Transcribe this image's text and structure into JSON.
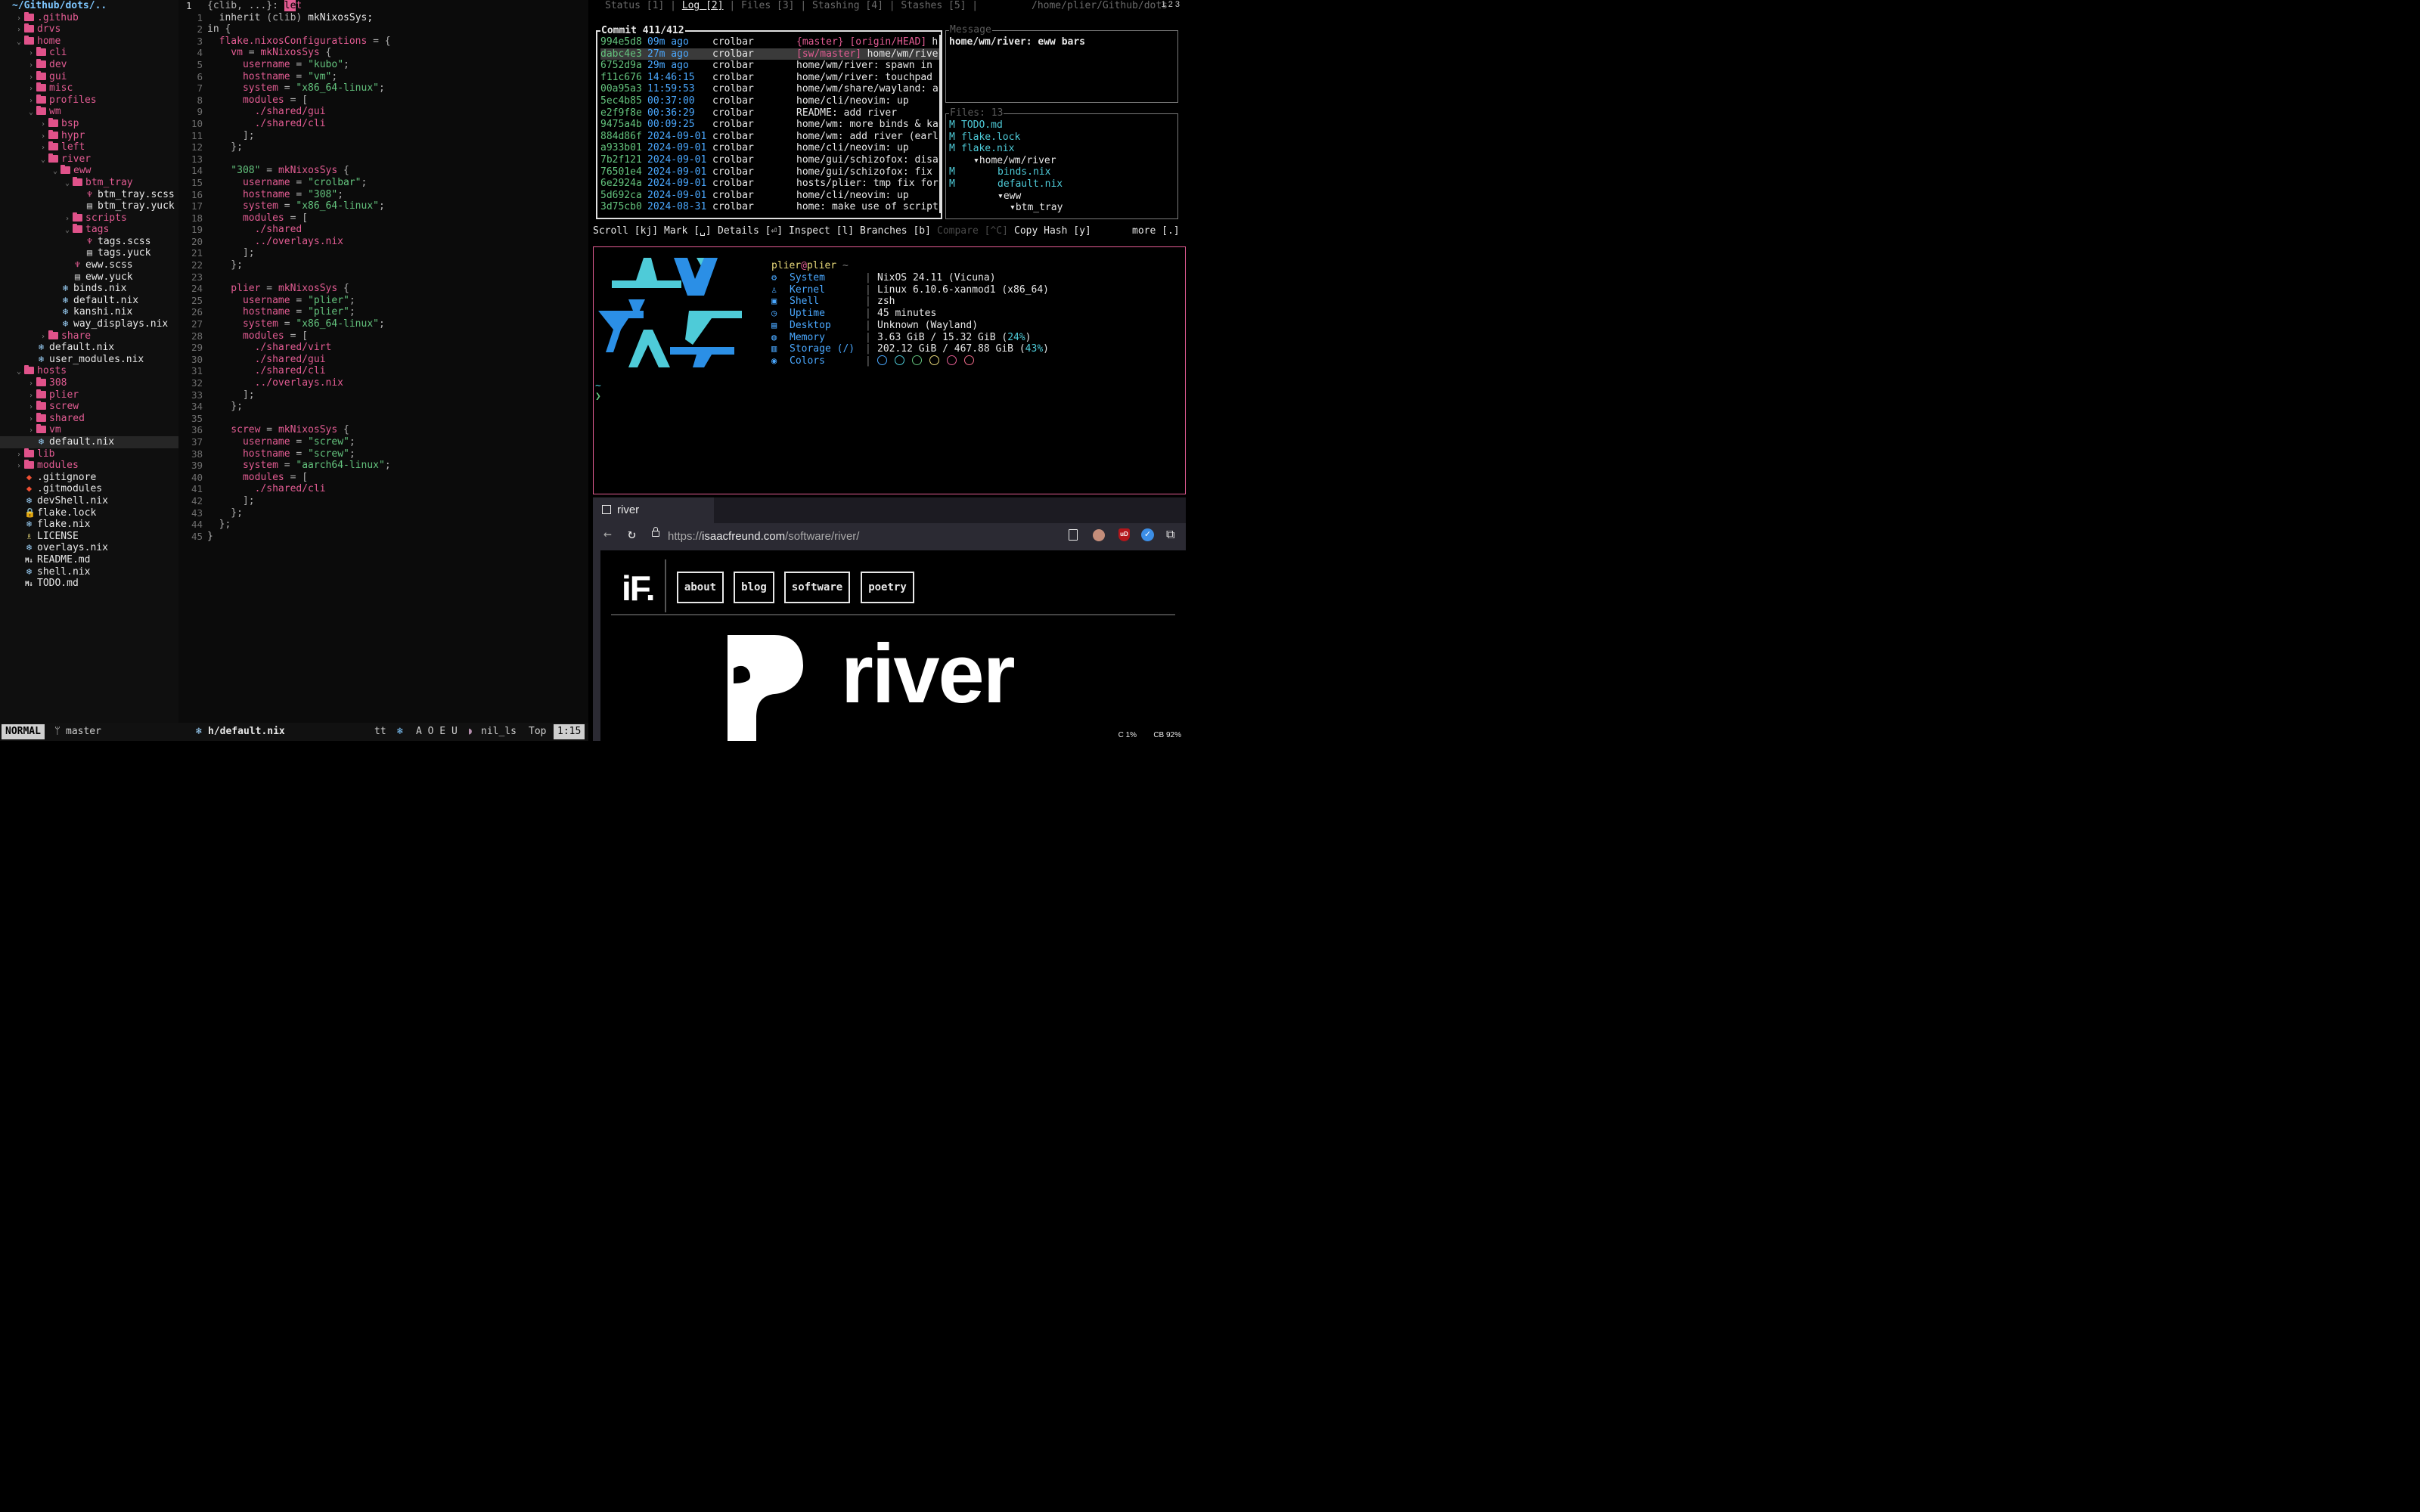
{
  "nvim": {
    "root": "~/Github/dots/..",
    "tree": [
      {
        "indent": 1,
        "chev": "›",
        "type": "dir",
        "name": ".github"
      },
      {
        "indent": 1,
        "chev": "›",
        "type": "dir",
        "name": "drvs"
      },
      {
        "indent": 1,
        "chev": "⌄",
        "type": "dir",
        "name": "home"
      },
      {
        "indent": 2,
        "chev": "›",
        "type": "dir",
        "name": "cli"
      },
      {
        "indent": 2,
        "chev": "›",
        "type": "dir",
        "name": "dev"
      },
      {
        "indent": 2,
        "chev": "›",
        "type": "dir",
        "name": "gui"
      },
      {
        "indent": 2,
        "chev": "›",
        "type": "dir",
        "name": "misc"
      },
      {
        "indent": 2,
        "chev": "›",
        "type": "dir",
        "name": "profiles"
      },
      {
        "indent": 2,
        "chev": "⌄",
        "type": "dir",
        "name": "wm"
      },
      {
        "indent": 3,
        "chev": "›",
        "type": "dir",
        "name": "bsp"
      },
      {
        "indent": 3,
        "chev": "›",
        "type": "dir",
        "name": "hypr"
      },
      {
        "indent": 3,
        "chev": "›",
        "type": "dir",
        "name": "left"
      },
      {
        "indent": 3,
        "chev": "⌄",
        "type": "dir",
        "name": "river"
      },
      {
        "indent": 4,
        "chev": "⌄",
        "type": "dir",
        "name": "eww"
      },
      {
        "indent": 5,
        "chev": "⌄",
        "type": "dir",
        "name": "btm_tray"
      },
      {
        "indent": 6,
        "chev": "",
        "type": "scss",
        "name": "btm_tray.scss"
      },
      {
        "indent": 6,
        "chev": "",
        "type": "yuck",
        "name": "btm_tray.yuck"
      },
      {
        "indent": 5,
        "chev": "›",
        "type": "dir",
        "name": "scripts"
      },
      {
        "indent": 5,
        "chev": "⌄",
        "type": "dir",
        "name": "tags"
      },
      {
        "indent": 6,
        "chev": "",
        "type": "scss",
        "name": "tags.scss"
      },
      {
        "indent": 6,
        "chev": "",
        "type": "yuck",
        "name": "tags.yuck"
      },
      {
        "indent": 5,
        "chev": "",
        "type": "scss",
        "name": "eww.scss"
      },
      {
        "indent": 5,
        "chev": "",
        "type": "yuck",
        "name": "eww.yuck"
      },
      {
        "indent": 4,
        "chev": "",
        "type": "nix",
        "name": "binds.nix"
      },
      {
        "indent": 4,
        "chev": "",
        "type": "nix",
        "name": "default.nix"
      },
      {
        "indent": 4,
        "chev": "",
        "type": "nix",
        "name": "kanshi.nix"
      },
      {
        "indent": 4,
        "chev": "",
        "type": "nix",
        "name": "way_displays.nix"
      },
      {
        "indent": 3,
        "chev": "›",
        "type": "dir",
        "name": "share"
      },
      {
        "indent": 2,
        "chev": "",
        "type": "nix",
        "name": "default.nix"
      },
      {
        "indent": 2,
        "chev": "",
        "type": "nix",
        "name": "user_modules.nix"
      },
      {
        "indent": 1,
        "chev": "⌄",
        "type": "dir",
        "name": "hosts"
      },
      {
        "indent": 2,
        "chev": "›",
        "type": "dir",
        "name": "308"
      },
      {
        "indent": 2,
        "chev": "›",
        "type": "dir",
        "name": "plier"
      },
      {
        "indent": 2,
        "chev": "›",
        "type": "dir",
        "name": "screw"
      },
      {
        "indent": 2,
        "chev": "›",
        "type": "dir",
        "name": "shared"
      },
      {
        "indent": 2,
        "chev": "›",
        "type": "dir",
        "name": "vm"
      },
      {
        "indent": 2,
        "chev": "",
        "type": "nix",
        "name": "default.nix",
        "selected": true
      },
      {
        "indent": 1,
        "chev": "›",
        "type": "dir",
        "name": "lib"
      },
      {
        "indent": 1,
        "chev": "›",
        "type": "dir",
        "name": "modules"
      },
      {
        "indent": 1,
        "chev": "",
        "type": "git",
        "name": ".gitignore"
      },
      {
        "indent": 1,
        "chev": "",
        "type": "git",
        "name": ".gitmodules"
      },
      {
        "indent": 1,
        "chev": "",
        "type": "nix",
        "name": "devShell.nix"
      },
      {
        "indent": 1,
        "chev": "",
        "type": "lock",
        "name": "flake.lock"
      },
      {
        "indent": 1,
        "chev": "",
        "type": "nix",
        "name": "flake.nix"
      },
      {
        "indent": 1,
        "chev": "",
        "type": "license",
        "name": "LICENSE"
      },
      {
        "indent": 1,
        "chev": "",
        "type": "nix",
        "name": "overlays.nix"
      },
      {
        "indent": 1,
        "chev": "",
        "type": "md",
        "name": "README.md"
      },
      {
        "indent": 1,
        "chev": "",
        "type": "nix",
        "name": "shell.nix"
      },
      {
        "indent": 1,
        "chev": "",
        "type": "md",
        "name": "TODO.md"
      }
    ],
    "line_numbers": [
      "1",
      "1",
      "2",
      "3",
      "4",
      "5",
      "6",
      "7",
      "8",
      "9",
      "10",
      "11",
      "12",
      "13",
      "14",
      "15",
      "16",
      "17",
      "18",
      "19",
      "20",
      "21",
      "22",
      "23",
      "24",
      "25",
      "26",
      "27",
      "28",
      "29",
      "30",
      "31",
      "32",
      "33",
      "34",
      "35",
      "36",
      "37",
      "38",
      "39",
      "40",
      "41",
      "42",
      "43",
      "44",
      "45"
    ],
    "code": [
      [
        [
          "p",
          "{clib, ...}: "
        ],
        [
          "cursor",
          "le"
        ],
        [
          "a",
          "t"
        ]
      ],
      [
        [
          "k",
          "  inherit "
        ],
        [
          "p",
          "(clib) "
        ],
        [
          "fn",
          "mkNixosSys;"
        ]
      ],
      [
        [
          "k",
          "in "
        ],
        [
          "p",
          "{"
        ]
      ],
      [
        [
          "a",
          "  flake.nixosConfigurations "
        ],
        [
          "p",
          "= {"
        ]
      ],
      [
        [
          "a",
          "    vm "
        ],
        [
          "p",
          "= "
        ],
        [
          "a",
          "mkNixosSys "
        ],
        [
          "p",
          "{"
        ]
      ],
      [
        [
          "a",
          "      username "
        ],
        [
          "p",
          "= "
        ],
        [
          "s",
          "\"kubo\""
        ],
        [
          "p",
          ";"
        ]
      ],
      [
        [
          "a",
          "      hostname "
        ],
        [
          "p",
          "= "
        ],
        [
          "s",
          "\"vm\""
        ],
        [
          "p",
          ";"
        ]
      ],
      [
        [
          "a",
          "      system "
        ],
        [
          "p",
          "= "
        ],
        [
          "s",
          "\"x86_64-linux\""
        ],
        [
          "p",
          ";"
        ]
      ],
      [
        [
          "a",
          "      modules "
        ],
        [
          "p",
          "= ["
        ]
      ],
      [
        [
          "path",
          "        ./shared/gui"
        ]
      ],
      [
        [
          "path",
          "        ./shared/cli"
        ]
      ],
      [
        [
          "p",
          "      ];"
        ]
      ],
      [
        [
          "p",
          "    };"
        ]
      ],
      [
        [
          "p",
          ""
        ]
      ],
      [
        [
          "s",
          "    \"308\" "
        ],
        [
          "p",
          "= "
        ],
        [
          "a",
          "mkNixosSys "
        ],
        [
          "p",
          "{"
        ]
      ],
      [
        [
          "a",
          "      username "
        ],
        [
          "p",
          "= "
        ],
        [
          "s",
          "\"crolbar\""
        ],
        [
          "p",
          ";"
        ]
      ],
      [
        [
          "a",
          "      hostname "
        ],
        [
          "p",
          "= "
        ],
        [
          "s",
          "\"308\""
        ],
        [
          "p",
          ";"
        ]
      ],
      [
        [
          "a",
          "      system "
        ],
        [
          "p",
          "= "
        ],
        [
          "s",
          "\"x86_64-linux\""
        ],
        [
          "p",
          ";"
        ]
      ],
      [
        [
          "a",
          "      modules "
        ],
        [
          "p",
          "= ["
        ]
      ],
      [
        [
          "path",
          "        ./shared"
        ]
      ],
      [
        [
          "path",
          "        ../overlays.nix"
        ]
      ],
      [
        [
          "p",
          "      ];"
        ]
      ],
      [
        [
          "p",
          "    };"
        ]
      ],
      [
        [
          "p",
          ""
        ]
      ],
      [
        [
          "a",
          "    plier "
        ],
        [
          "p",
          "= "
        ],
        [
          "a",
          "mkNixosSys "
        ],
        [
          "p",
          "{"
        ]
      ],
      [
        [
          "a",
          "      username "
        ],
        [
          "p",
          "= "
        ],
        [
          "s",
          "\"plier\""
        ],
        [
          "p",
          ";"
        ]
      ],
      [
        [
          "a",
          "      hostname "
        ],
        [
          "p",
          "= "
        ],
        [
          "s",
          "\"plier\""
        ],
        [
          "p",
          ";"
        ]
      ],
      [
        [
          "a",
          "      system "
        ],
        [
          "p",
          "= "
        ],
        [
          "s",
          "\"x86_64-linux\""
        ],
        [
          "p",
          ";"
        ]
      ],
      [
        [
          "a",
          "      modules "
        ],
        [
          "p",
          "= ["
        ]
      ],
      [
        [
          "path",
          "        ./shared/virt"
        ]
      ],
      [
        [
          "path",
          "        ./shared/gui"
        ]
      ],
      [
        [
          "path",
          "        ./shared/cli"
        ]
      ],
      [
        [
          "path",
          "        ../overlays.nix"
        ]
      ],
      [
        [
          "p",
          "      ];"
        ]
      ],
      [
        [
          "p",
          "    };"
        ]
      ],
      [
        [
          "p",
          ""
        ]
      ],
      [
        [
          "a",
          "    screw "
        ],
        [
          "p",
          "= "
        ],
        [
          "a",
          "mkNixosSys "
        ],
        [
          "p",
          "{"
        ]
      ],
      [
        [
          "a",
          "      username "
        ],
        [
          "p",
          "= "
        ],
        [
          "s",
          "\"screw\""
        ],
        [
          "p",
          ";"
        ]
      ],
      [
        [
          "a",
          "      hostname "
        ],
        [
          "p",
          "= "
        ],
        [
          "s",
          "\"screw\""
        ],
        [
          "p",
          ";"
        ]
      ],
      [
        [
          "a",
          "      system "
        ],
        [
          "p",
          "= "
        ],
        [
          "s",
          "\"aarch64-linux\""
        ],
        [
          "p",
          ";"
        ]
      ],
      [
        [
          "a",
          "      modules "
        ],
        [
          "p",
          "= ["
        ]
      ],
      [
        [
          "path",
          "        ./shared/cli"
        ]
      ],
      [
        [
          "p",
          "      ];"
        ]
      ],
      [
        [
          "p",
          "    };"
        ]
      ],
      [
        [
          "p",
          "  };"
        ]
      ],
      [
        [
          "p",
          "}"
        ]
      ]
    ],
    "status": {
      "mode": "NORMAL",
      "branch": "master",
      "file": "h/default.nix",
      "ft": "tt",
      "layout": "A O E U",
      "lsp": "nil_ls",
      "scroll": "Top",
      "pos": "1:15"
    }
  },
  "lazygit": {
    "tabs": [
      "Status [1]",
      "Log [2]",
      "Files [3]",
      "Stashing [4]",
      "Stashes [5]"
    ],
    "active_tab": "Log [2]",
    "path": "/home/plier/Github/dots",
    "ws": "1 2 3",
    "commit_title": "Commit 411/412",
    "commits": [
      {
        "hash": "994e5d8",
        "ago": "09m ago",
        "author": "crolbar",
        "tag": "{master} [origin/HEAD]",
        "msg": "h"
      },
      {
        "hash": "dabc4e3",
        "ago": "27m ago",
        "author": "crolbar",
        "tag": "[sw/master]",
        "msg": "home/wm/rive",
        "selected": true
      },
      {
        "hash": "6752d9a",
        "ago": "29m ago",
        "author": "crolbar",
        "tag": "",
        "msg": "home/wm/river: spawn in"
      },
      {
        "hash": "f11c676",
        "ago": "14:46:15",
        "author": "crolbar",
        "tag": "",
        "msg": "home/wm/river: touchpad"
      },
      {
        "hash": "00a95a3",
        "ago": "11:59:53",
        "author": "crolbar",
        "tag": "",
        "msg": "home/wm/share/wayland: a"
      },
      {
        "hash": "5ec4b85",
        "ago": "00:37:00",
        "author": "crolbar",
        "tag": "",
        "msg": "home/cli/neovim: up"
      },
      {
        "hash": "e2f9f8e",
        "ago": "00:36:29",
        "author": "crolbar",
        "tag": "",
        "msg": "README: add river"
      },
      {
        "hash": "9475a4b",
        "ago": "00:09:25",
        "author": "crolbar",
        "tag": "",
        "msg": "home/wm: more binds & ka"
      },
      {
        "hash": "884d86f",
        "ago": "2024-09-01",
        "author": "crolbar",
        "tag": "",
        "msg": "home/wm: add river (earl"
      },
      {
        "hash": "a933b01",
        "ago": "2024-09-01",
        "author": "crolbar",
        "tag": "",
        "msg": "home/cli/neovim: up"
      },
      {
        "hash": "7b2f121",
        "ago": "2024-09-01",
        "author": "crolbar",
        "tag": "",
        "msg": "home/gui/schizofox: disa"
      },
      {
        "hash": "76501e4",
        "ago": "2024-09-01",
        "author": "crolbar",
        "tag": "",
        "msg": "home/gui/schizofox: fix"
      },
      {
        "hash": "6e2924a",
        "ago": "2024-09-01",
        "author": "crolbar",
        "tag": "",
        "msg": "hosts/plier: tmp fix for"
      },
      {
        "hash": "5d692ca",
        "ago": "2024-09-01",
        "author": "crolbar",
        "tag": "",
        "msg": "home/cli/neovim: up"
      },
      {
        "hash": "3d75cb0",
        "ago": "2024-08-31",
        "author": "crolbar",
        "tag": "",
        "msg": "home: make use of script"
      }
    ],
    "message_title": "Message",
    "message": "home/wm/river: eww bars",
    "files_title": "Files: 13",
    "files": [
      {
        "m": "M",
        "indent": 0,
        "name": "TODO.md"
      },
      {
        "m": "M",
        "indent": 0,
        "name": "flake.lock"
      },
      {
        "m": "M",
        "indent": 0,
        "name": "flake.nix"
      },
      {
        "m": "",
        "indent": 1,
        "name": "▾home/wm/river",
        "dir": true
      },
      {
        "m": "M",
        "indent": 3,
        "name": "binds.nix"
      },
      {
        "m": "M",
        "indent": 3,
        "name": "default.nix"
      },
      {
        "m": "",
        "indent": 3,
        "name": "▾eww",
        "dir": true
      },
      {
        "m": "",
        "indent": 4,
        "name": "▾btm_tray",
        "dir": true
      }
    ],
    "keybar": [
      {
        "label": "Scroll [kj]",
        "dim": false
      },
      {
        "label": "Mark [␣]",
        "dim": false
      },
      {
        "label": "Details [⏎]",
        "dim": false
      },
      {
        "label": "Inspect [l]",
        "dim": false
      },
      {
        "label": "Branches [b]",
        "dim": false
      },
      {
        "label": "Compare [^C]",
        "dim": true
      },
      {
        "label": "Copy Hash [y]",
        "dim": false
      },
      {
        "label": "more [.]",
        "dim": false
      }
    ]
  },
  "terminal": {
    "user": "plier",
    "at": "@",
    "host": "plier",
    "tilde": "~",
    "info": [
      {
        "icon": "gear-icon",
        "glyph": "⚙",
        "label": "System",
        "value": "NixOS 24.11 (Vicuna)"
      },
      {
        "icon": "penguin-icon",
        "glyph": "♙",
        "label": "Kernel",
        "value": "Linux 6.10.6-xanmod1 (x86_64)"
      },
      {
        "icon": "shell-icon",
        "glyph": "▣",
        "label": "Shell",
        "value": "zsh"
      },
      {
        "icon": "clock-icon",
        "glyph": "◷",
        "label": "Uptime",
        "value": "45 minutes"
      },
      {
        "icon": "desktop-icon",
        "glyph": "▤",
        "label": "Desktop",
        "value": "Unknown (Wayland)"
      },
      {
        "icon": "memory-icon",
        "glyph": "◍",
        "label": "Memory",
        "value": "3.63 GiB / 15.32 GiB (",
        "pct": "24%",
        "tail": ")"
      },
      {
        "icon": "storage-icon",
        "glyph": "▥",
        "label": "Storage (/)",
        "value": "202.12 GiB / 467.88 GiB (",
        "pct": "43%",
        "tail": ")"
      },
      {
        "icon": "palette-icon",
        "glyph": "◉",
        "label": "Colors",
        "value": ""
      }
    ],
    "colors": [
      "#4aa8ff",
      "#4ecbd8",
      "#64c47e",
      "#e8d97a",
      "#e35c93",
      "#f06a8a"
    ],
    "prompt_tilde": "~",
    "prompt": "❯"
  },
  "browser": {
    "tab_title": "river",
    "url_prefix": "https://",
    "url_domain": "isaacfreund.com",
    "url_path": "/software/river/",
    "nav": [
      "about",
      "blog",
      "software",
      "poetry"
    ],
    "logo_text": "iF.",
    "hero_text": "river",
    "ublock": "uD"
  },
  "wm_status": {
    "cpu": "C 1%",
    "battery": "CB 92%"
  }
}
